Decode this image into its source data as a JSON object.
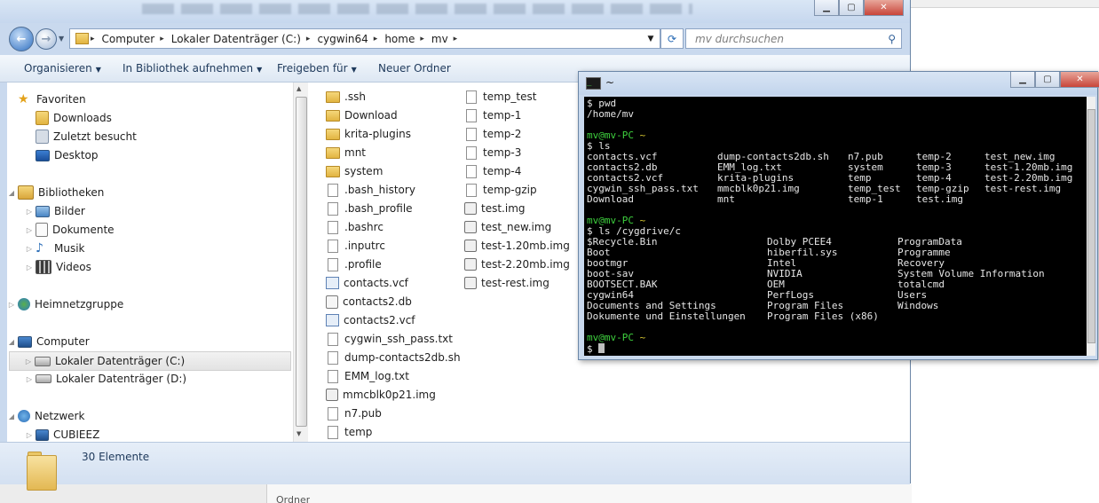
{
  "explorer": {
    "breadcrumb": [
      "Computer",
      "Lokaler Datenträger (C:)",
      "cygwin64",
      "home",
      "mv"
    ],
    "search_placeholder": "mv durchsuchen",
    "toolbar": {
      "organize": "Organisieren",
      "library": "In Bibliothek aufnehmen",
      "share": "Freigeben für",
      "new_folder": "Neuer Ordner"
    },
    "nav": {
      "favorites": "Favoriten",
      "downloads": "Downloads",
      "recent": "Zuletzt besucht",
      "desktop": "Desktop",
      "libraries": "Bibliotheken",
      "pictures": "Bilder",
      "documents": "Dokumente",
      "music": "Musik",
      "videos": "Videos",
      "homegroup": "Heimnetzgruppe",
      "computer": "Computer",
      "drive_c": "Lokaler Datenträger (C:)",
      "drive_d": "Lokaler Datenträger (D:)",
      "network": "Netzwerk",
      "cubieez": "CUBIEEZ"
    },
    "files_col1": [
      ".ssh",
      "Download",
      "krita-plugins",
      "mnt",
      "system",
      ".bash_history",
      ".bash_profile",
      ".bashrc",
      ".inputrc",
      ".profile",
      "contacts.vcf",
      "contacts2.db",
      "contacts2.vcf",
      "cygwin_ssh_pass.txt",
      "dump-contacts2db.sh",
      "EMM_log.txt",
      "mmcblk0p21.img",
      "n7.pub",
      "temp"
    ],
    "files_col2": [
      "temp_test",
      "temp-1",
      "temp-2",
      "temp-3",
      "temp-4",
      "temp-gzip",
      "test.img",
      "test_new.img",
      "test-1.20mb.img",
      "test-2.20mb.img",
      "test-rest.img"
    ],
    "status": "30 Elemente"
  },
  "terminal": {
    "title": "~",
    "l1": "$ pwd",
    "l2": "/home/mv",
    "prompt": "mv@mv-PC",
    "tilde": "~",
    "cmd_ls": "$ ls",
    "ls_col1": [
      "contacts.vcf",
      "contacts2.db",
      "contacts2.vcf",
      "cygwin_ssh_pass.txt",
      "Download"
    ],
    "ls_col2": [
      "dump-contacts2db.sh",
      "EMM_log.txt",
      "krita-plugins",
      "mmcblk0p21.img",
      "mnt"
    ],
    "ls_col3": [
      "n7.pub",
      "system",
      "temp",
      "temp_test",
      "temp-1"
    ],
    "ls_col4": [
      "temp-2",
      "temp-3",
      "temp-4",
      "temp-gzip",
      "test.img"
    ],
    "ls_col5": [
      "test_new.img",
      "test-1.20mb.img",
      "test-2.20mb.img",
      "test-rest.img"
    ],
    "cmd_ls_c": "$ ls /cygdrive/c",
    "c_col1": [
      "$Recycle.Bin",
      "Boot",
      "bootmgr",
      "boot-sav",
      "BOOTSECT.BAK",
      "cygwin64",
      "Documents and Settings",
      "Dokumente und Einstellungen"
    ],
    "c_col2": [
      "Dolby PCEE4",
      "hiberfil.sys",
      "Intel",
      "NVIDIA",
      "OEM",
      "PerfLogs",
      "Program Files",
      "Program Files (x86)"
    ],
    "c_col3": [
      "ProgramData",
      "Programme",
      "Recovery",
      "System Volume Information",
      "totalcmd",
      "Users",
      "Windows"
    ],
    "last": "$ "
  },
  "colors": {
    "prompt_green": "#3ed03e",
    "prompt_yellow": "#d8c832",
    "accent": "#2f6fc0"
  },
  "background": {
    "bottom_text": "Ordner"
  }
}
